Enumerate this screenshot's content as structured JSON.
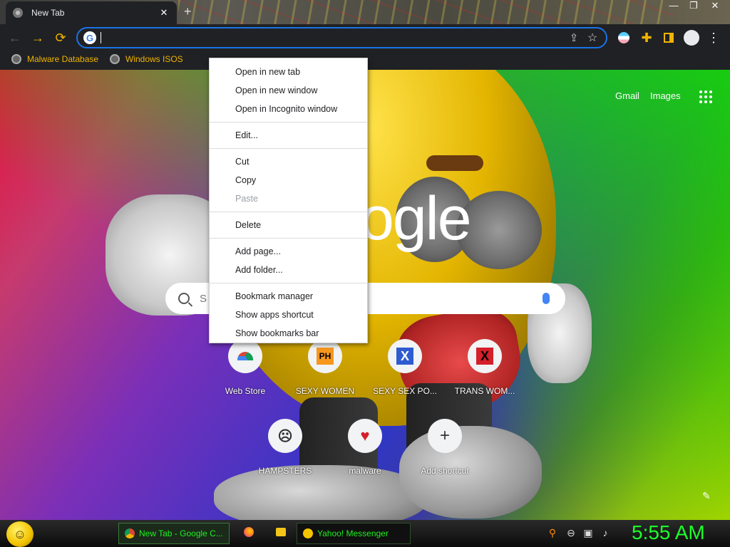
{
  "tab": {
    "title": "New Tab",
    "close": "✕",
    "new_tab": "+"
  },
  "window_controls": {
    "minimize": "—",
    "restore": "❐",
    "close": "✕"
  },
  "toolbar": {
    "back": "←",
    "forward": "→",
    "reload": "⟳",
    "omnibox_value": "",
    "share": "⇪",
    "star": "☆",
    "extensions": "✚",
    "menu": "⋮"
  },
  "bookmarks": [
    {
      "label": "Malware Database"
    },
    {
      "label": "Windows ISOS"
    }
  ],
  "ntp": {
    "gmail": "Gmail",
    "images": "Images",
    "logo_text": "ogle",
    "search_placeholder": "S",
    "edit": "✎",
    "shortcuts": [
      {
        "label": "Web Store",
        "glyph": ""
      },
      {
        "label": "SEXY WOMEN",
        "glyph": "PH"
      },
      {
        "label": "SEXY SEX PO...",
        "glyph": "X"
      },
      {
        "label": "TRANS WOM...",
        "glyph": "X"
      },
      {
        "label": "HAMPSTERS",
        "glyph": "☹"
      },
      {
        "label": "malware",
        "glyph": "♥"
      },
      {
        "label": "Add shortcut",
        "glyph": "+"
      }
    ]
  },
  "context_menu": {
    "groups": [
      [
        "Open in new tab",
        "Open in new window",
        "Open in Incognito window"
      ],
      [
        "Edit..."
      ],
      [
        "Cut",
        "Copy",
        "Paste"
      ],
      [
        "Delete"
      ],
      [
        "Add page...",
        "Add folder..."
      ],
      [
        "Bookmark manager",
        "Show apps shortcut",
        "Show bookmarks bar"
      ]
    ],
    "disabled": [
      "Paste"
    ]
  },
  "taskbar": {
    "tasks": [
      {
        "label": "New Tab - Google C..."
      },
      {
        "label": "Yahoo! Messenger"
      }
    ],
    "clock": "5:55 AM"
  },
  "colors": {
    "accent_blue": "#1a73e8",
    "bookmark_text": "#f0b400",
    "clock_green": "#1dff2a"
  }
}
